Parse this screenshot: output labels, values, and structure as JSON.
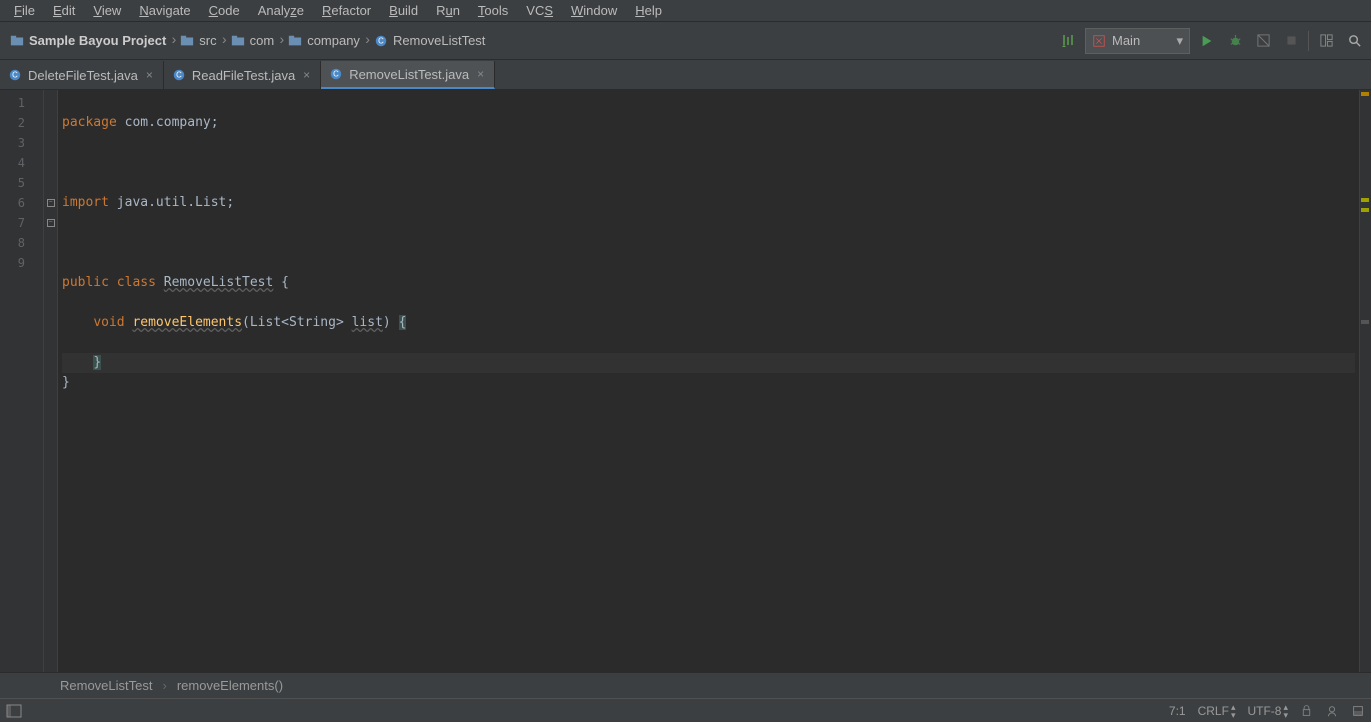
{
  "menus": [
    "File",
    "Edit",
    "View",
    "Navigate",
    "Code",
    "Analyze",
    "Refactor",
    "Build",
    "Run",
    "Tools",
    "VCS",
    "Window",
    "Help"
  ],
  "breadcrumbs": {
    "project": "Sample Bayou Project",
    "items": [
      "src",
      "com",
      "company",
      "RemoveListTest"
    ]
  },
  "run_config": {
    "label": "Main"
  },
  "tabs": [
    {
      "label": "DeleteFileTest.java",
      "active": false
    },
    {
      "label": "ReadFileTest.java",
      "active": false
    },
    {
      "label": "RemoveListTest.java",
      "active": true
    }
  ],
  "line_numbers": [
    "1",
    "2",
    "3",
    "4",
    "5",
    "6",
    "7",
    "8",
    "9"
  ],
  "code": {
    "l1_kw": "package",
    "l1_rest": " com.company;",
    "l3_kw": "import",
    "l3_rest": " java.util.List;",
    "l5_kw1": "public",
    "l5_kw2": "class",
    "l5_class": "RemoveListTest",
    "l5_end": " {",
    "l6_kw": "void",
    "l6_method": "removeElements",
    "l6_open": "(",
    "l6_type": "List<String>",
    "l6_param": "list",
    "l6_close": ") ",
    "l6_brace": "{",
    "l7_brace": "}",
    "l8_brace": "}"
  },
  "nav": {
    "class": "RemoveListTest",
    "method": "removeElements()"
  },
  "status": {
    "pos": "7:1",
    "line_sep": "CRLF",
    "encoding": "UTF-8"
  }
}
